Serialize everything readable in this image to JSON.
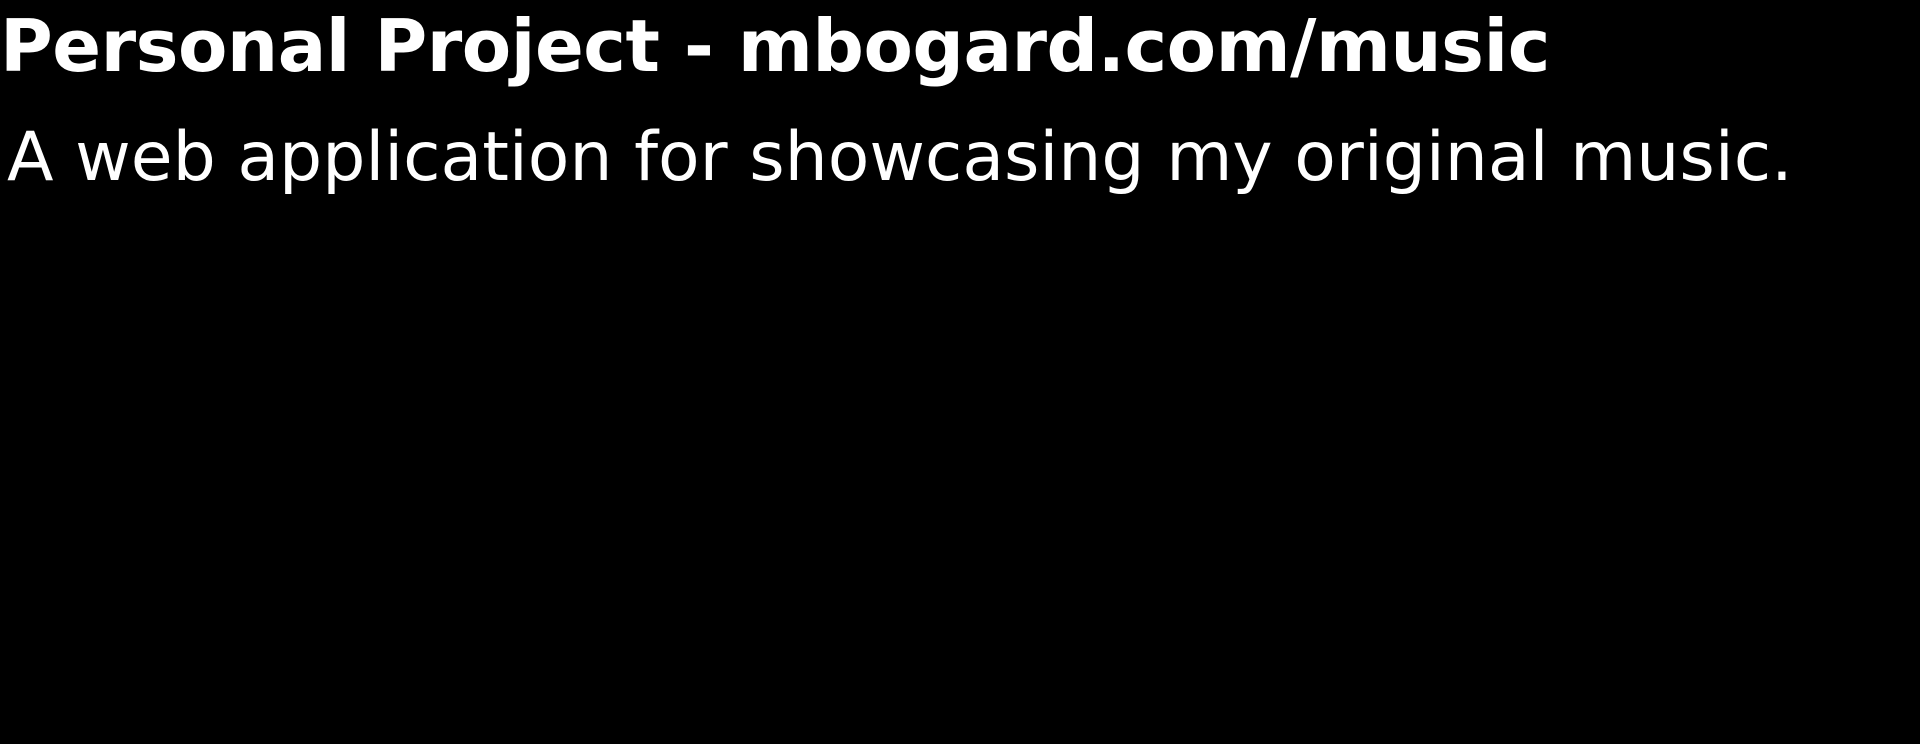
{
  "project": {
    "title": "Personal Project - mbogard.com/music",
    "description": "A web application for showcasing my original music."
  },
  "colors": {
    "background": "#000000",
    "text": "#ffffff"
  }
}
